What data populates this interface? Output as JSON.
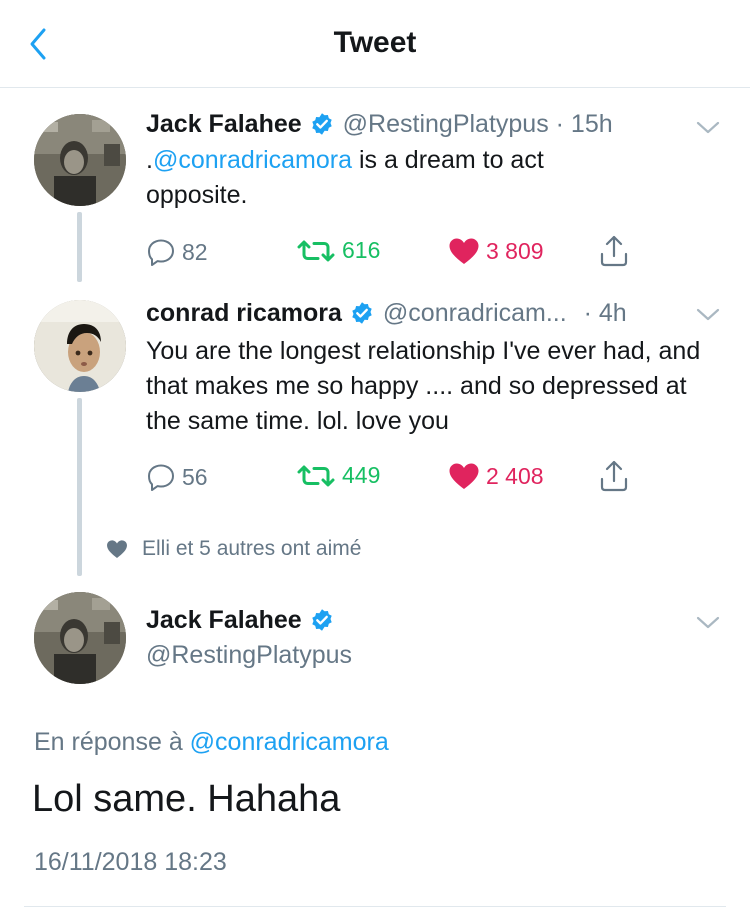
{
  "header": {
    "title": "Tweet"
  },
  "tweets": [
    {
      "display_name": "Jack Falahee",
      "handle": "@RestingPlatypus",
      "time_separator": " · ",
      "time": "15h",
      "text_prefix": ".",
      "mention": "@conradricamora",
      "text_rest": " is a dream to act opposite.",
      "replies": "82",
      "retweets": "616",
      "likes": "3 809"
    },
    {
      "display_name": "conrad ricamora",
      "handle": "@conradricam...",
      "time_separator": " · ",
      "time": "4h",
      "text": "You are the longest relationship I've ever had, and that makes me so happy .... and so depressed at the same time. lol. love you",
      "replies": "56",
      "retweets": "449",
      "likes": "2 408"
    }
  ],
  "liked_by": "Elli et 5 autres ont aimé",
  "focused_tweet": {
    "display_name": "Jack Falahee",
    "handle": "@RestingPlatypus",
    "reply_prefix": "En réponse à ",
    "reply_mention": "@conradricamora",
    "text": "Lol same. Hahaha",
    "timestamp": "16/11/2018 18:23"
  },
  "colors": {
    "accent": "#1da1f2",
    "retweet": "#17bf63",
    "like": "#e0245e",
    "secondary_text": "#657786"
  },
  "icons": [
    "back-chevron-icon",
    "verified-badge-icon",
    "chevron-down-icon",
    "reply-icon",
    "retweet-icon",
    "heart-icon",
    "share-icon"
  ]
}
